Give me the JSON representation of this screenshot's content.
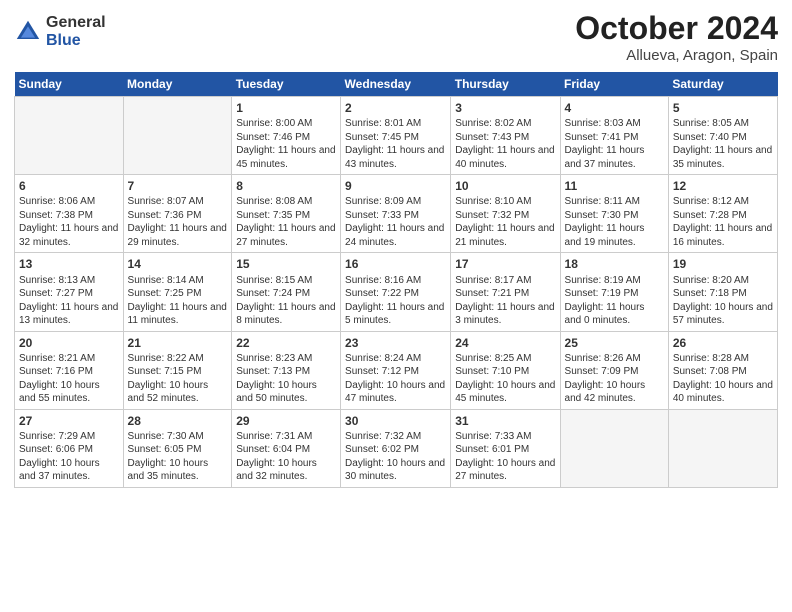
{
  "logo": {
    "general": "General",
    "blue": "Blue"
  },
  "title": "October 2024",
  "location": "Allueva, Aragon, Spain",
  "days_of_week": [
    "Sunday",
    "Monday",
    "Tuesday",
    "Wednesday",
    "Thursday",
    "Friday",
    "Saturday"
  ],
  "weeks": [
    [
      {
        "day": "",
        "empty": true
      },
      {
        "day": "",
        "empty": true
      },
      {
        "day": "1",
        "sunrise": "8:00 AM",
        "sunset": "7:46 PM",
        "daylight": "11 hours and 45 minutes."
      },
      {
        "day": "2",
        "sunrise": "8:01 AM",
        "sunset": "7:45 PM",
        "daylight": "11 hours and 43 minutes."
      },
      {
        "day": "3",
        "sunrise": "8:02 AM",
        "sunset": "7:43 PM",
        "daylight": "11 hours and 40 minutes."
      },
      {
        "day": "4",
        "sunrise": "8:03 AM",
        "sunset": "7:41 PM",
        "daylight": "11 hours and 37 minutes."
      },
      {
        "day": "5",
        "sunrise": "8:05 AM",
        "sunset": "7:40 PM",
        "daylight": "11 hours and 35 minutes."
      }
    ],
    [
      {
        "day": "6",
        "sunrise": "8:06 AM",
        "sunset": "7:38 PM",
        "daylight": "11 hours and 32 minutes."
      },
      {
        "day": "7",
        "sunrise": "8:07 AM",
        "sunset": "7:36 PM",
        "daylight": "11 hours and 29 minutes."
      },
      {
        "day": "8",
        "sunrise": "8:08 AM",
        "sunset": "7:35 PM",
        "daylight": "11 hours and 27 minutes."
      },
      {
        "day": "9",
        "sunrise": "8:09 AM",
        "sunset": "7:33 PM",
        "daylight": "11 hours and 24 minutes."
      },
      {
        "day": "10",
        "sunrise": "8:10 AM",
        "sunset": "7:32 PM",
        "daylight": "11 hours and 21 minutes."
      },
      {
        "day": "11",
        "sunrise": "8:11 AM",
        "sunset": "7:30 PM",
        "daylight": "11 hours and 19 minutes."
      },
      {
        "day": "12",
        "sunrise": "8:12 AM",
        "sunset": "7:28 PM",
        "daylight": "11 hours and 16 minutes."
      }
    ],
    [
      {
        "day": "13",
        "sunrise": "8:13 AM",
        "sunset": "7:27 PM",
        "daylight": "11 hours and 13 minutes."
      },
      {
        "day": "14",
        "sunrise": "8:14 AM",
        "sunset": "7:25 PM",
        "daylight": "11 hours and 11 minutes."
      },
      {
        "day": "15",
        "sunrise": "8:15 AM",
        "sunset": "7:24 PM",
        "daylight": "11 hours and 8 minutes."
      },
      {
        "day": "16",
        "sunrise": "8:16 AM",
        "sunset": "7:22 PM",
        "daylight": "11 hours and 5 minutes."
      },
      {
        "day": "17",
        "sunrise": "8:17 AM",
        "sunset": "7:21 PM",
        "daylight": "11 hours and 3 minutes."
      },
      {
        "day": "18",
        "sunrise": "8:19 AM",
        "sunset": "7:19 PM",
        "daylight": "11 hours and 0 minutes."
      },
      {
        "day": "19",
        "sunrise": "8:20 AM",
        "sunset": "7:18 PM",
        "daylight": "10 hours and 57 minutes."
      }
    ],
    [
      {
        "day": "20",
        "sunrise": "8:21 AM",
        "sunset": "7:16 PM",
        "daylight": "10 hours and 55 minutes."
      },
      {
        "day": "21",
        "sunrise": "8:22 AM",
        "sunset": "7:15 PM",
        "daylight": "10 hours and 52 minutes."
      },
      {
        "day": "22",
        "sunrise": "8:23 AM",
        "sunset": "7:13 PM",
        "daylight": "10 hours and 50 minutes."
      },
      {
        "day": "23",
        "sunrise": "8:24 AM",
        "sunset": "7:12 PM",
        "daylight": "10 hours and 47 minutes."
      },
      {
        "day": "24",
        "sunrise": "8:25 AM",
        "sunset": "7:10 PM",
        "daylight": "10 hours and 45 minutes."
      },
      {
        "day": "25",
        "sunrise": "8:26 AM",
        "sunset": "7:09 PM",
        "daylight": "10 hours and 42 minutes."
      },
      {
        "day": "26",
        "sunrise": "8:28 AM",
        "sunset": "7:08 PM",
        "daylight": "10 hours and 40 minutes."
      }
    ],
    [
      {
        "day": "27",
        "sunrise": "7:29 AM",
        "sunset": "6:06 PM",
        "daylight": "10 hours and 37 minutes."
      },
      {
        "day": "28",
        "sunrise": "7:30 AM",
        "sunset": "6:05 PM",
        "daylight": "10 hours and 35 minutes."
      },
      {
        "day": "29",
        "sunrise": "7:31 AM",
        "sunset": "6:04 PM",
        "daylight": "10 hours and 32 minutes."
      },
      {
        "day": "30",
        "sunrise": "7:32 AM",
        "sunset": "6:02 PM",
        "daylight": "10 hours and 30 minutes."
      },
      {
        "day": "31",
        "sunrise": "7:33 AM",
        "sunset": "6:01 PM",
        "daylight": "10 hours and 27 minutes."
      },
      {
        "day": "",
        "empty": true
      },
      {
        "day": "",
        "empty": true
      }
    ]
  ]
}
